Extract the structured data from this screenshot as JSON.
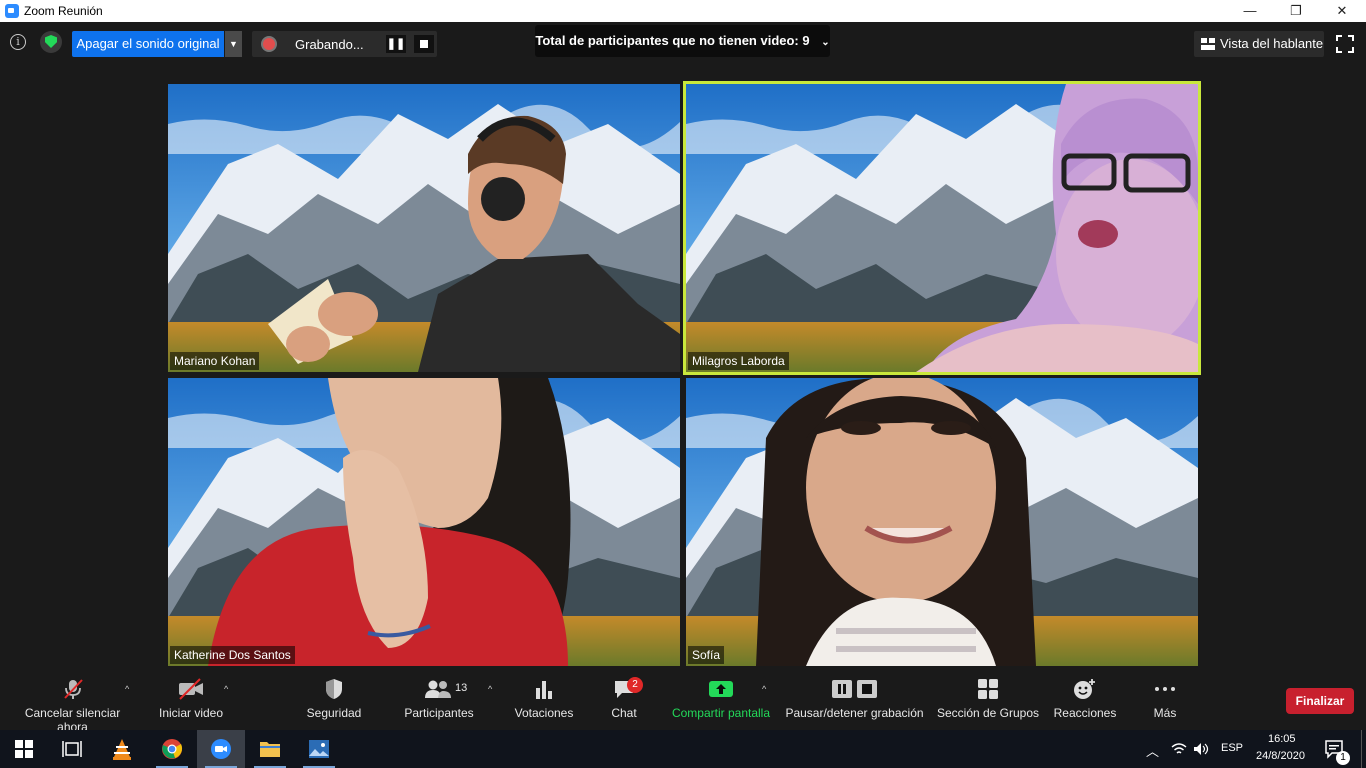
{
  "window": {
    "title": "Zoom Reunión",
    "minimize": "—",
    "maximize": "❐",
    "close": "✕"
  },
  "topbar": {
    "original_sound_button": "Apagar el sonido original",
    "recording_status": "Grabando...",
    "no_video_count_text": "Total de participantes que no tienen video: 9",
    "speaker_view_button": "Vista del hablante"
  },
  "participants": [
    {
      "name": "Mariano Kohan",
      "active_speaker": false
    },
    {
      "name": "Milagros Laborda",
      "active_speaker": true
    },
    {
      "name": "Katherine Dos Santos",
      "active_speaker": false
    },
    {
      "name": "Sofía",
      "active_speaker": false
    }
  ],
  "toolbar": {
    "unmute": "Cancelar silenciar ahora",
    "start_video": "Iniciar video",
    "security": "Seguridad",
    "participants": "Participantes",
    "participants_count": "13",
    "polls": "Votaciones",
    "chat": "Chat",
    "chat_badge": "2",
    "share_screen": "Compartir pantalla",
    "pause_stop_recording": "Pausar/detener grabación",
    "breakout_rooms": "Sección de Grupos",
    "reactions": "Reacciones",
    "more": "Más",
    "end": "Finalizar"
  },
  "taskbar": {
    "language": "ESP",
    "time": "16:05",
    "date": "24/8/2020",
    "notification_count": "1"
  },
  "colors": {
    "accent_blue": "#0e72ed",
    "active_speaker": "#c9e83c",
    "end_red": "#c8202e",
    "share_green": "#23d959"
  }
}
